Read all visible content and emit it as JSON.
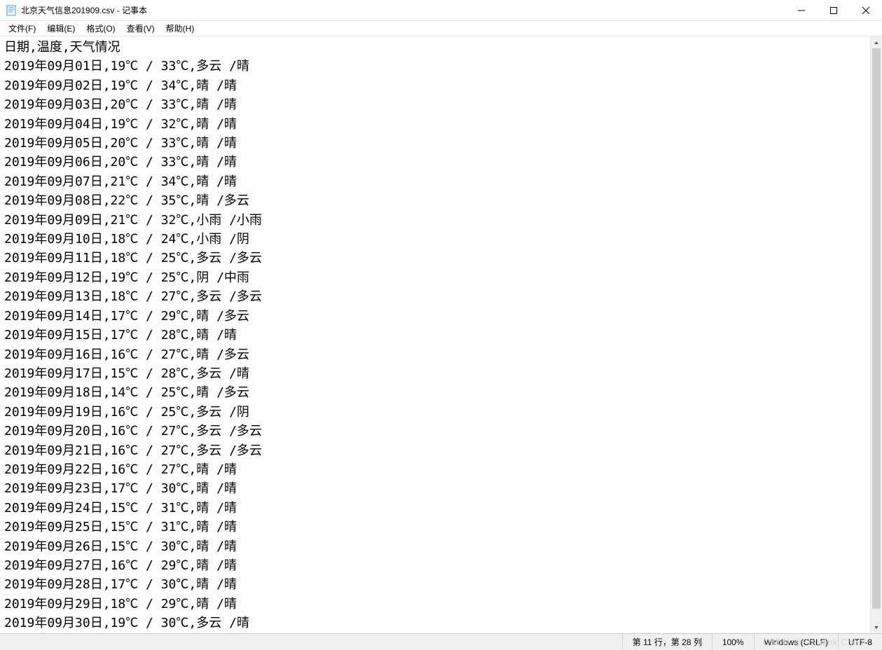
{
  "titlebar": {
    "title": "北京天气信息201909.csv - 记事本"
  },
  "menu": {
    "file": "文件(F)",
    "edit": "编辑(E)",
    "format": "格式(O)",
    "view": "查看(V)",
    "help": "帮助(H)"
  },
  "content": {
    "header": "日期,温度,天气情况",
    "rows": [
      "2019年09月01日,19℃ / 33℃,多云 /晴",
      "2019年09月02日,19℃ / 34℃,晴 /晴",
      "2019年09月03日,20℃ / 33℃,晴 /晴",
      "2019年09月04日,19℃ / 32℃,晴 /晴",
      "2019年09月05日,20℃ / 33℃,晴 /晴",
      "2019年09月06日,20℃ / 33℃,晴 /晴",
      "2019年09月07日,21℃ / 34℃,晴 /晴",
      "2019年09月08日,22℃ / 35℃,晴 /多云",
      "2019年09月09日,21℃ / 32℃,小雨 /小雨",
      "2019年09月10日,18℃ / 24℃,小雨 /阴",
      "2019年09月11日,18℃ / 25℃,多云 /多云",
      "2019年09月12日,19℃ / 25℃,阴 /中雨",
      "2019年09月13日,18℃ / 27℃,多云 /多云",
      "2019年09月14日,17℃ / 29℃,晴 /多云",
      "2019年09月15日,17℃ / 28℃,晴 /晴",
      "2019年09月16日,16℃ / 27℃,晴 /多云",
      "2019年09月17日,15℃ / 28℃,多云 /晴",
      "2019年09月18日,14℃ / 25℃,晴 /多云",
      "2019年09月19日,16℃ / 25℃,多云 /阴",
      "2019年09月20日,16℃ / 27℃,多云 /多云",
      "2019年09月21日,16℃ / 27℃,多云 /多云",
      "2019年09月22日,16℃ / 27℃,晴 /晴",
      "2019年09月23日,17℃ / 30℃,晴 /晴",
      "2019年09月24日,15℃ / 31℃,晴 /晴",
      "2019年09月25日,15℃ / 31℃,晴 /晴",
      "2019年09月26日,15℃ / 30℃,晴 /晴",
      "2019年09月27日,16℃ / 29℃,晴 /晴",
      "2019年09月28日,17℃ / 30℃,晴 /晴",
      "2019年09月29日,18℃ / 29℃,晴 /晴",
      "2019年09月30日,19℃ / 30℃,多云 /晴"
    ]
  },
  "statusbar": {
    "position": "第 11 行，第 28 列",
    "zoom": "100%",
    "line_ending": "Windows (CRLF)",
    "encoding": "UTF-8"
  },
  "watermark": "CSDN @Francek Chen"
}
